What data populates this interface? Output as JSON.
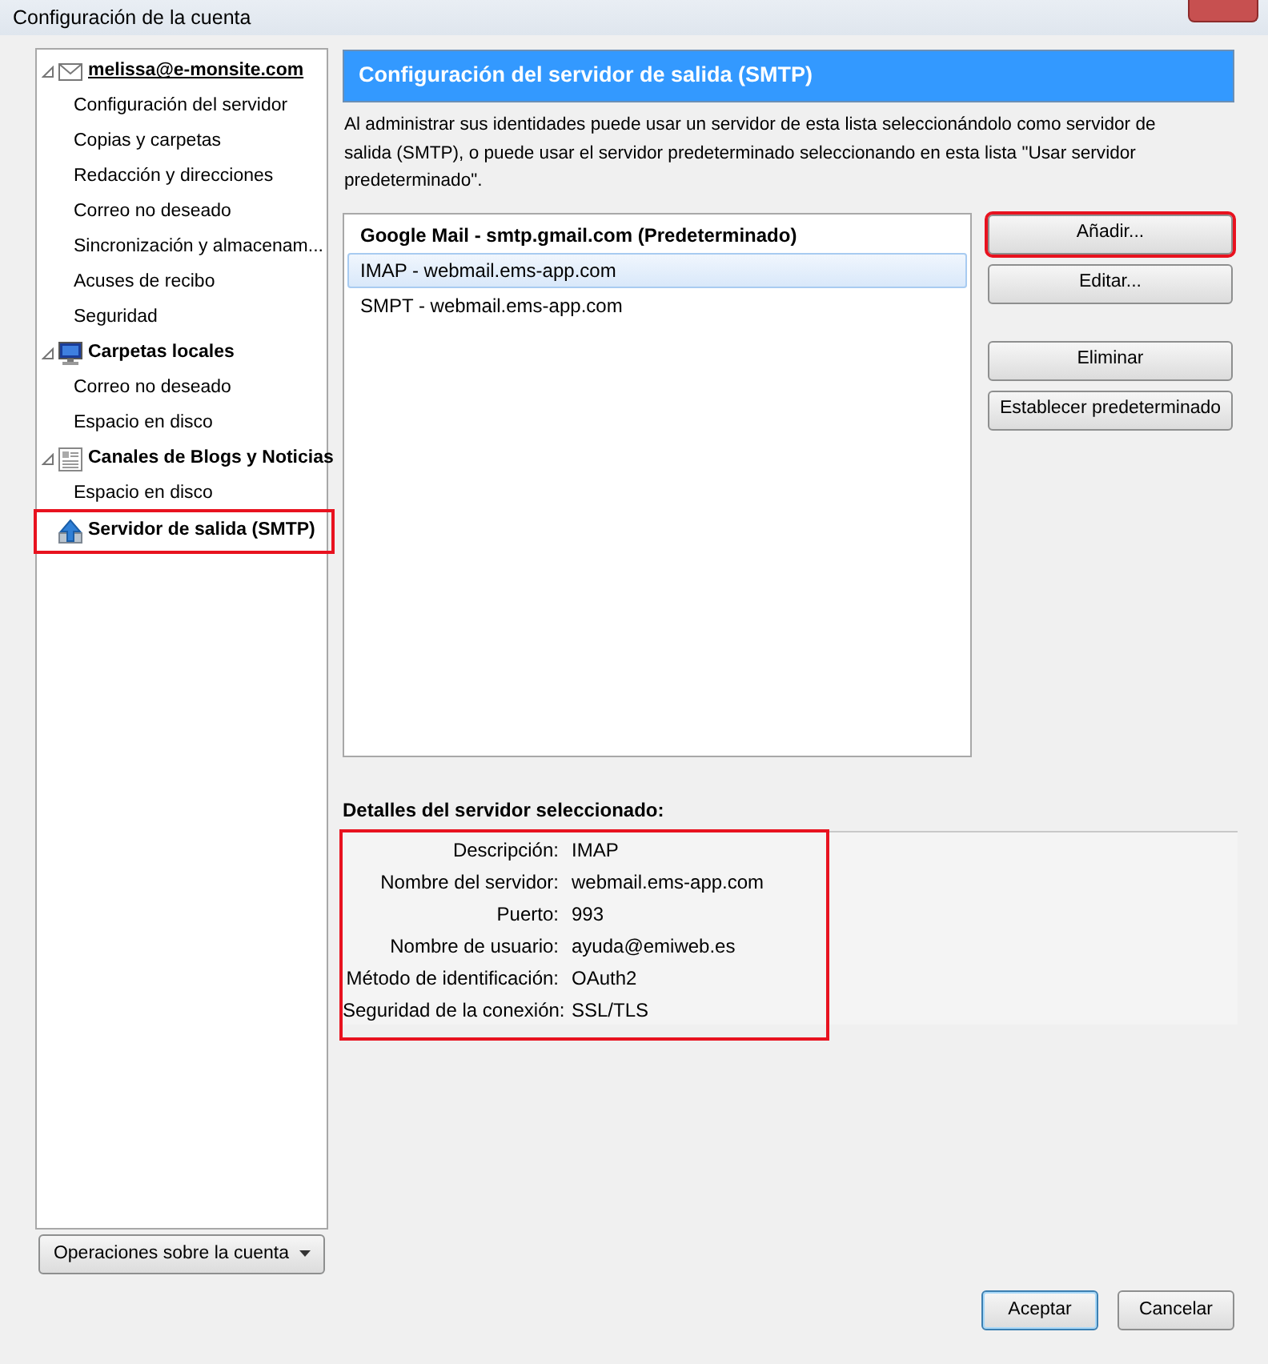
{
  "window": {
    "title": "Configuración de la cuenta"
  },
  "tree": [
    {
      "label": "melissa@e-monsite.com",
      "kind": "mail",
      "selected": false,
      "children": [
        {
          "label": "Configuración del servidor"
        },
        {
          "label": "Copias y carpetas"
        },
        {
          "label": "Redacción y direcciones"
        },
        {
          "label": "Correo no deseado"
        },
        {
          "label": "Sincronización y almacenam..."
        },
        {
          "label": "Acuses de recibo"
        },
        {
          "label": "Seguridad"
        }
      ]
    },
    {
      "label": "Carpetas locales",
      "kind": "local",
      "selected": false,
      "children": [
        {
          "label": "Correo no deseado"
        },
        {
          "label": "Espacio en disco"
        }
      ]
    },
    {
      "label": "Canales de Blogs y Noticias",
      "kind": "feeds",
      "selected": false,
      "children": [
        {
          "label": "Espacio en disco"
        }
      ]
    },
    {
      "label": "Servidor de salida (SMTP)",
      "kind": "smtp",
      "selected": true
    }
  ],
  "account_actions_button": "Operaciones sobre la cuenta",
  "header": "Configuración del servidor de salida (SMTP)",
  "description": "Al administrar sus identidades puede usar un servidor de esta lista seleccionándolo como servidor de salida (SMTP), o puede usar el servidor predeterminado seleccionando en esta lista \"Usar servidor predeterminado\".",
  "servers": [
    {
      "label": "Google Mail - smtp.gmail.com (Predeterminado)",
      "default": true,
      "selected": false
    },
    {
      "label": "IMAP - webmail.ems-app.com",
      "default": false,
      "selected": true
    },
    {
      "label": "SMPT - webmail.ems-app.com",
      "default": false,
      "selected": false
    }
  ],
  "server_buttons": [
    {
      "label": "Añadir...",
      "highlighted": true
    },
    {
      "label": "Editar...",
      "highlighted": false
    },
    {
      "label": "Eliminar",
      "highlighted": false
    },
    {
      "label": "Establecer predeterminado",
      "highlighted": false
    }
  ],
  "details": {
    "title": "Detalles del servidor seleccionado:",
    "highlighted": true,
    "rows": [
      {
        "label": "Descripción:",
        "value": "IMAP"
      },
      {
        "label": "Nombre del servidor:",
        "value": "webmail.ems-app.com"
      },
      {
        "label": "Puerto:",
        "value": "993"
      },
      {
        "label": "Nombre de usuario:",
        "value": "ayuda@emiweb.es"
      },
      {
        "label": "Método de identificación:",
        "value": "OAuth2"
      },
      {
        "label": "Seguridad de la conexión:",
        "value": "SSL/TLS"
      }
    ]
  },
  "dialog_buttons": [
    {
      "label": "Aceptar",
      "kind": "default"
    },
    {
      "label": "Cancelar",
      "kind": "normal"
    }
  ]
}
